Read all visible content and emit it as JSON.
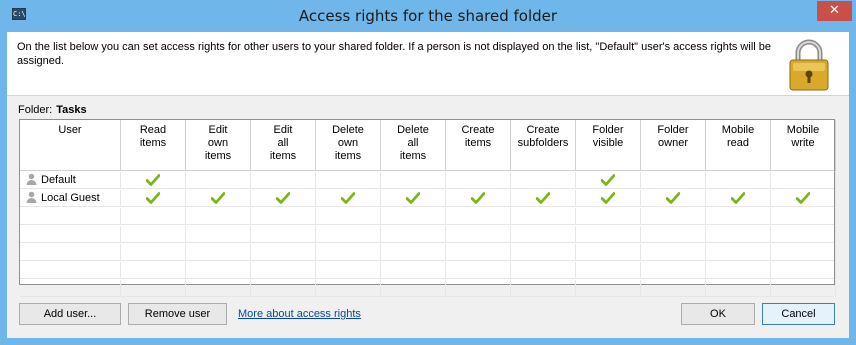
{
  "window": {
    "title": "Access rights for the shared folder",
    "app_icon": "C:\\",
    "close_glyph": "✕"
  },
  "header": {
    "description": "On the list below you can set access rights for other users to your shared folder. If a person is not displayed on the list, \"Default\" user's access rights will be assigned.",
    "icon": "padlock-icon"
  },
  "folder": {
    "label": "Folder:",
    "name": "Tasks"
  },
  "grid": {
    "columns": [
      {
        "label": "User"
      },
      {
        "label": "Read\nitems"
      },
      {
        "label": "Edit\nown\nitems"
      },
      {
        "label": "Edit\nall\nitems"
      },
      {
        "label": "Delete\nown\nitems"
      },
      {
        "label": "Delete\nall\nitems"
      },
      {
        "label": "Create\nitems"
      },
      {
        "label": "Create\nsubfolders"
      },
      {
        "label": "Folder\nvisible"
      },
      {
        "label": "Folder\nowner"
      },
      {
        "label": "Mobile\nread"
      },
      {
        "label": "Mobile\nwrite"
      }
    ],
    "rows": [
      {
        "user": "Default",
        "rights": [
          true,
          false,
          false,
          false,
          false,
          false,
          false,
          true,
          false,
          false,
          false
        ]
      },
      {
        "user": "Local Guest",
        "rights": [
          true,
          true,
          true,
          true,
          true,
          true,
          true,
          true,
          true,
          true,
          true
        ]
      }
    ],
    "empty_rows": 5,
    "check_color": "#7cb518"
  },
  "buttons": {
    "add_user": "Add user...",
    "remove_user": "Remove user",
    "more_link": "More about access rights",
    "ok": "OK",
    "cancel": "Cancel"
  }
}
